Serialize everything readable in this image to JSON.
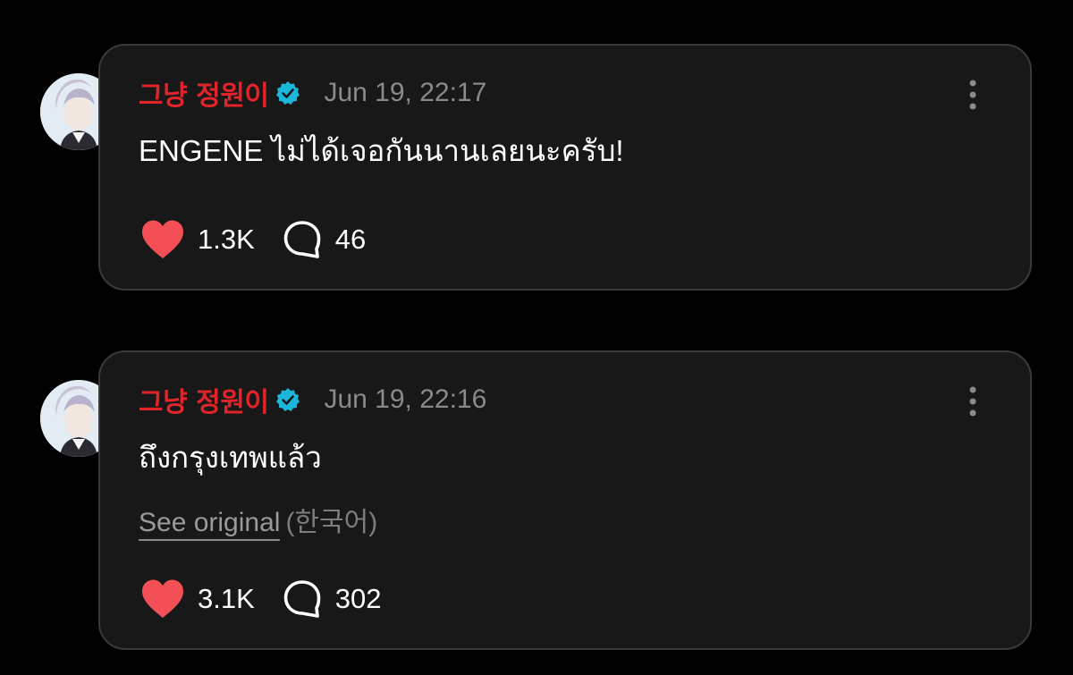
{
  "posts": [
    {
      "author": "그냥 정원이",
      "timestamp": "Jun 19, 22:17",
      "text": "ENGENE ไม่ได้เจอกันนานเลยนะครับ!",
      "likes": "1.3K",
      "comments": "46"
    },
    {
      "author": "그냥 정원이",
      "timestamp": "Jun 19, 22:16",
      "text": "ถึงกรุงเทพแล้ว",
      "see_original_label": "See original",
      "original_language": "(한국어)",
      "likes": "3.1K",
      "comments": "302"
    }
  ],
  "icons": {
    "verified": "verified-badge-icon",
    "more": "more-vertical-icon",
    "like": "heart-icon",
    "comment": "comment-bubble-icon",
    "avatar": "avatar"
  },
  "colors": {
    "author": "#e0242a",
    "verified": "#1bb6d9",
    "heart": "#f25056",
    "card": "#181818",
    "background": "#000000"
  }
}
